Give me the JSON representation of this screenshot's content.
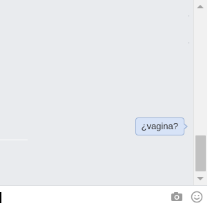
{
  "conversation": {
    "messages": [
      {
        "text": "¿vagina?",
        "direction": "outgoing"
      }
    ]
  },
  "composer": {
    "input_value": "",
    "camera_icon": "camera-icon",
    "emoji_icon": "emoji-icon"
  },
  "colors": {
    "conversation_background": "#e9ebee",
    "bubble_fill": "#d7e3f7",
    "bubble_border": "#9cb3d8",
    "icon_gray": "#9b9b9b"
  }
}
